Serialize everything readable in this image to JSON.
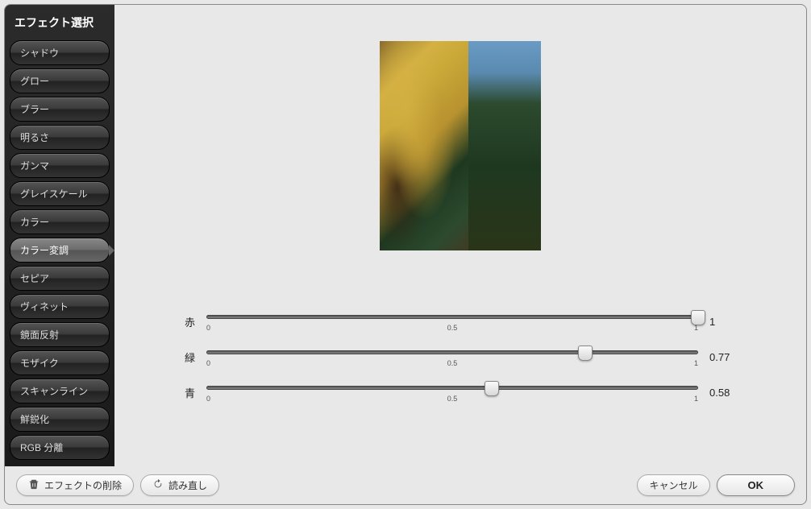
{
  "sidebar": {
    "title": "エフェクト選択",
    "items": [
      {
        "label": "シャドウ"
      },
      {
        "label": "グロー"
      },
      {
        "label": "ブラー"
      },
      {
        "label": "明るさ"
      },
      {
        "label": "ガンマ"
      },
      {
        "label": "グレイスケール"
      },
      {
        "label": "カラー"
      },
      {
        "label": "カラー変調"
      },
      {
        "label": "セピア"
      },
      {
        "label": "ヴィネット"
      },
      {
        "label": "鏡面反射"
      },
      {
        "label": "モザイク"
      },
      {
        "label": "スキャンライン"
      },
      {
        "label": "鮮鋭化"
      },
      {
        "label": "RGB 分離"
      }
    ],
    "selected_index": 7
  },
  "sliders": {
    "red": {
      "label": "赤",
      "value": 1,
      "display": "1",
      "min": 0,
      "mid": "0.5",
      "max": 1
    },
    "green": {
      "label": "緑",
      "value": 0.77,
      "display": "0.77",
      "min": 0,
      "mid": "0.5",
      "max": 1
    },
    "blue": {
      "label": "青",
      "value": 0.58,
      "display": "0.58",
      "min": 0,
      "mid": "0.5",
      "max": 1
    }
  },
  "footer": {
    "delete_label": "エフェクトの削除",
    "reload_label": "読み直し",
    "cancel_label": "キャンセル",
    "ok_label": "OK"
  }
}
